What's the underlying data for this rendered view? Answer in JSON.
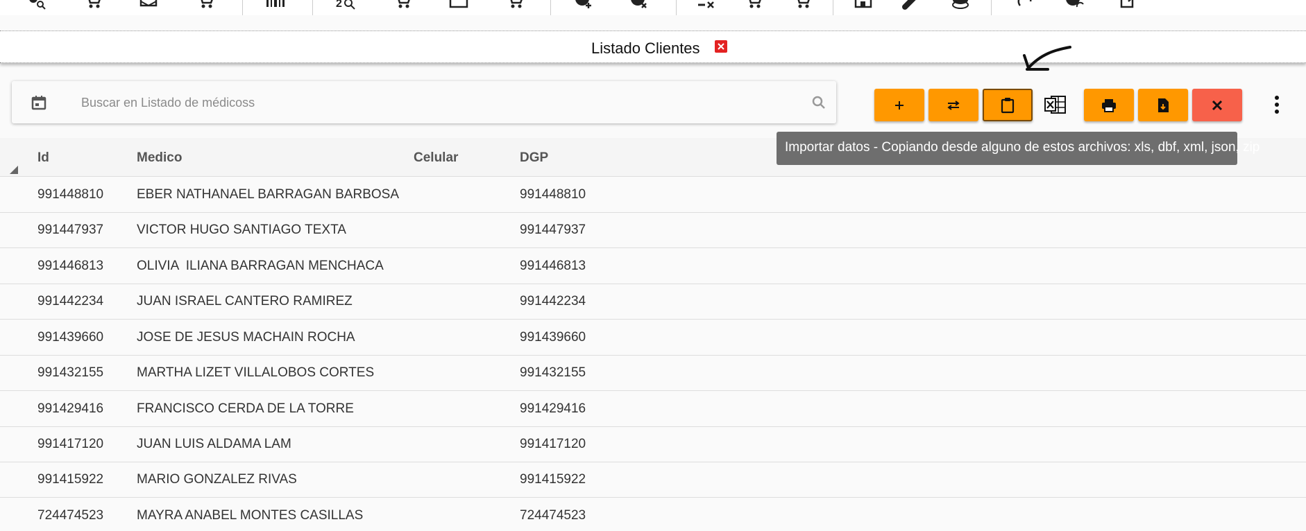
{
  "top_toolbar": {
    "icons": [
      "person-search-icon",
      "cart-icon",
      "mail-icon",
      "cart-icon",
      "barcode-icon",
      "zoom-icon",
      "cart-icon",
      "box-icon",
      "cart-icon",
      "add-cart-icon",
      "remove-cart-icon",
      "remove-item-icon",
      "cart-icon",
      "cart-icon",
      "store-icon",
      "pill-icon",
      "coins-icon",
      "sync-icon",
      "sync-cart-icon",
      "export-icon"
    ]
  },
  "tab": {
    "title": "Listado Clientes"
  },
  "search": {
    "placeholder": "Buscar en Listado de médicoss"
  },
  "actions": {
    "add": "add-icon",
    "swap": "swap-icon",
    "import": "clipboard-icon",
    "excel": "excel-icon",
    "print": "print-icon",
    "pdf": "pdf-file-icon",
    "close": "close-icon",
    "more": "more-vertical-icon"
  },
  "tooltip": {
    "text": "Importar datos - Copiando desde alguno de estos archivos: xls, dbf, xml, json, zip"
  },
  "table": {
    "headers": {
      "id": "Id",
      "medico": "Medico",
      "celular": "Celular",
      "dgp": "DGP"
    },
    "rows": [
      {
        "id": "991448810",
        "medico": "EBER NATHANAEL BARRAGAN BARBOSA",
        "celular": "",
        "dgp": "991448810"
      },
      {
        "id": "991447937",
        "medico": "VICTOR HUGO SANTIAGO TEXTA",
        "celular": "",
        "dgp": "991447937"
      },
      {
        "id": "991446813",
        "medico": "OLIVIA  ILIANA BARRAGAN MENCHACA",
        "celular": "",
        "dgp": "991446813"
      },
      {
        "id": "991442234",
        "medico": "JUAN ISRAEL CANTERO RAMIREZ",
        "celular": "",
        "dgp": "991442234"
      },
      {
        "id": "991439660",
        "medico": "JOSE DE JESUS MACHAIN ROCHA",
        "celular": "",
        "dgp": "991439660"
      },
      {
        "id": "991432155",
        "medico": "MARTHA LIZET VILLALOBOS CORTES",
        "celular": "",
        "dgp": "991432155"
      },
      {
        "id": "991429416",
        "medico": "FRANCISCO CERDA DE LA TORRE",
        "celular": "",
        "dgp": "991429416"
      },
      {
        "id": "991417120",
        "medico": "JUAN LUIS ALDAMA LAM",
        "celular": "",
        "dgp": "991417120"
      },
      {
        "id": "991415922",
        "medico": "MARIO GONZALEZ RIVAS",
        "celular": "",
        "dgp": "991415922"
      },
      {
        "id": "724474523",
        "medico": "MAYRA ANABEL MONTES CASILLAS",
        "celular": "",
        "dgp": "724474523"
      }
    ]
  },
  "colors": {
    "accent": "#ff9800",
    "danger": "#f7614a",
    "tooltip": "#6e6e6e",
    "tab_close": "#e32222"
  }
}
